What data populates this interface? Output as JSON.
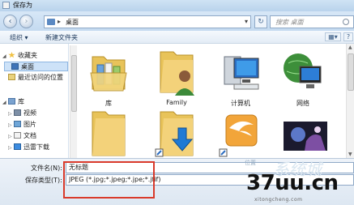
{
  "window": {
    "title": "保存为"
  },
  "navbar": {
    "back": "‹",
    "forward": "›",
    "address_separator": "▸",
    "address": "桌面",
    "address_dropdown": "▾",
    "refresh": "↻",
    "search_placeholder": "搜索 桌面"
  },
  "toolbar": {
    "organize": "组织",
    "organize_arrow": "▾",
    "new_folder": "新建文件夹",
    "view": "▦▾",
    "help": "?"
  },
  "sidebar": {
    "items": [
      {
        "label": "收藏夹",
        "toggle": "◢",
        "icon": "star-icon"
      },
      {
        "label": "桌面",
        "icon": "desktop-icon",
        "selected": true
      },
      {
        "label": "最近访问的位置",
        "icon": "recent-places-icon"
      },
      {
        "label": "库",
        "toggle": "◢",
        "icon": "libraries-icon"
      },
      {
        "label": "视频",
        "toggle": "▷",
        "icon": "video-icon"
      },
      {
        "label": "图片",
        "toggle": "▷",
        "icon": "pictures-icon"
      },
      {
        "label": "文档",
        "toggle": "▷",
        "icon": "documents-icon"
      },
      {
        "label": "迅雷下载",
        "toggle": "▷",
        "icon": "xunlei-download-icon"
      }
    ]
  },
  "content": {
    "items": [
      {
        "label": "库",
        "icon": "library-folder-icon"
      },
      {
        "label": "Family",
        "icon": "user-folder-icon"
      },
      {
        "label": "计算机",
        "icon": "computer-icon"
      },
      {
        "label": "网络",
        "icon": "network-icon"
      },
      {
        "label": "",
        "icon": "folder-icon"
      },
      {
        "label": "",
        "icon": "download-folder-icon"
      },
      {
        "label": "",
        "icon": "thunder-app-icon"
      },
      {
        "label": "",
        "icon": "image-thumbnail-icon"
      }
    ]
  },
  "bottom": {
    "filename_label": "文件名(N):",
    "filename_value": "无标题",
    "filetype_label": "保存类型(T):",
    "filetype_value": "JPEG (*.jpg;*.jpeg;*.jpe;*.jfif)"
  },
  "watermark": {
    "text": "37uu.cn",
    "url": "xitongcheng.com",
    "tag": "位置",
    "bg": "系统城"
  },
  "colors": {
    "accent": "#cde2f8",
    "highlight_border": "#d93a2b"
  }
}
